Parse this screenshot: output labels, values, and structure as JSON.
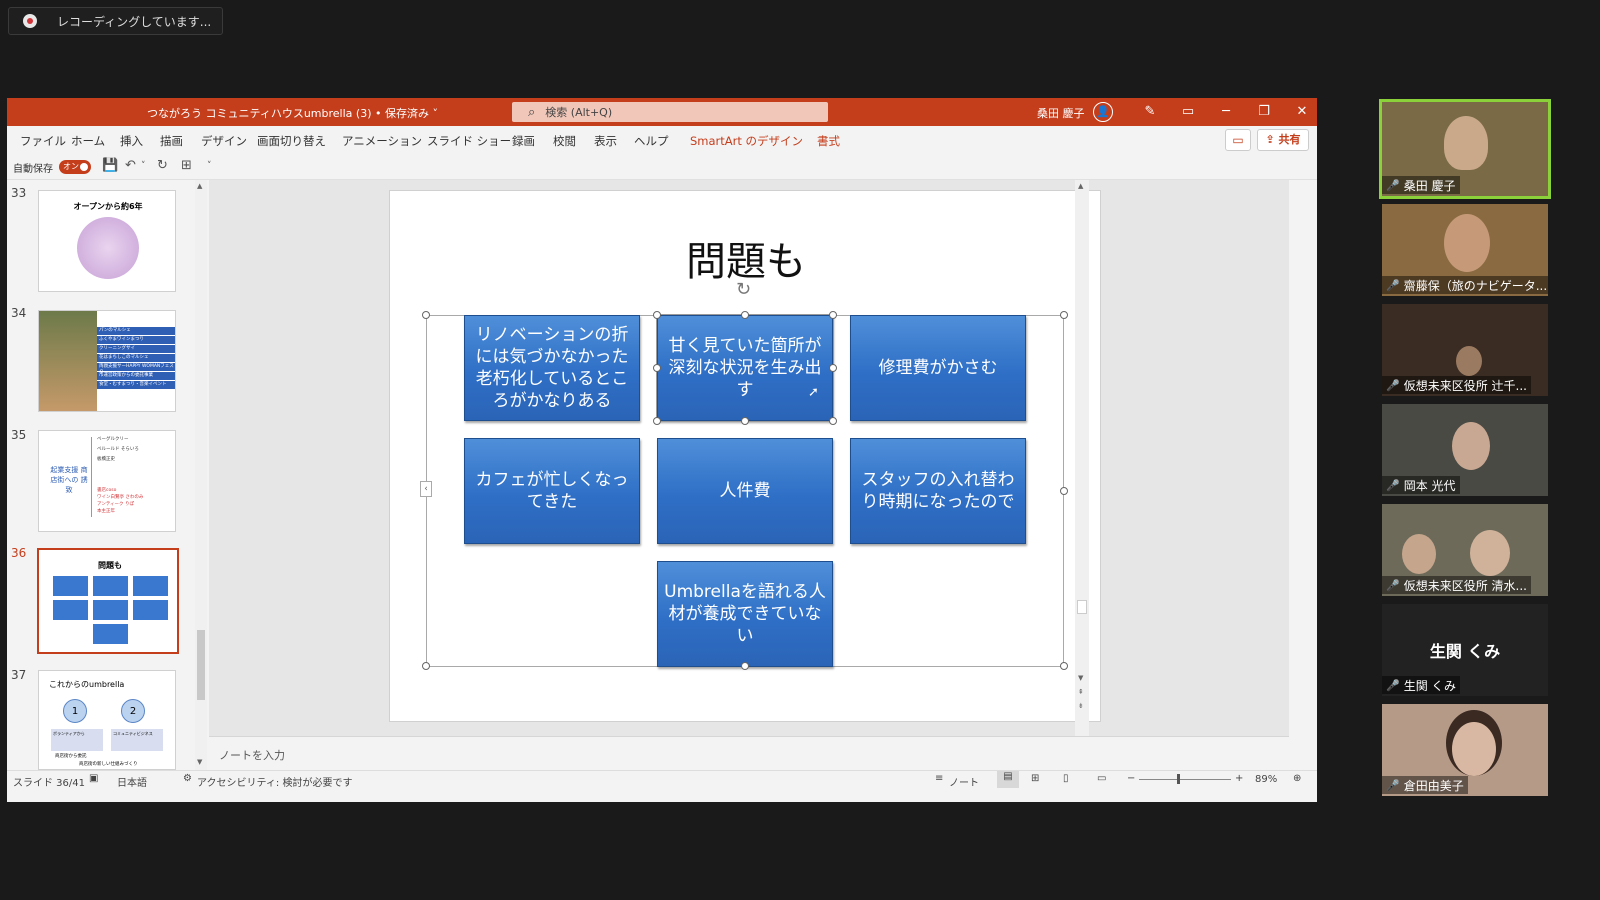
{
  "recording": {
    "label": "レコーディングしています..."
  },
  "powerpoint": {
    "doc_title": "つながろう コミュニティハウスumbrella (3) • 保存済み ˅",
    "search_placeholder": "検索 (Alt+Q)",
    "user_name": "桑田 慶子",
    "menu": [
      "ファイル",
      "ホーム",
      "挿入",
      "描画",
      "デザイン",
      "画面切り替え",
      "アニメーション",
      "スライド ショー",
      "録画",
      "校閲",
      "表示",
      "ヘルプ",
      "SmartArt のデザイン",
      "書式"
    ],
    "share_label": "共有",
    "autosave_label": "自動保存",
    "autosave_state": "オン",
    "thumbnails": [
      {
        "num": "33",
        "title": "オープンから約6年"
      },
      {
        "num": "34",
        "items": [
          "パンのマルシェ",
          "ふくやまワインまつり",
          "クリーニングサイ",
          "花はまちしこのマルシェ",
          "両親支援サーHAPPY WOMANフェスタ",
          "市運営政策からの委託事業",
          "食堂・むすまつり・音楽イベント"
        ]
      },
      {
        "num": "35",
        "title": "起業支援 商店街への 誘致",
        "bullets": [
          "ベーグルクリー",
          "ベルールド そらいろ",
          "板橋正史"
        ],
        "red": [
          "書店coso",
          "ワイン白鷺亭 さわのみ",
          "アンティーク りぽ",
          "本主正年"
        ]
      },
      {
        "num": "36",
        "title": "問題も",
        "current": true
      },
      {
        "num": "37",
        "title": "これからのumbrella",
        "n1": "1",
        "n2": "2",
        "t1": "ボランティアから",
        "t2": "コミュニティビジネス",
        "t3": "自立自主型の運営",
        "t4": "自立自主型の運営",
        "c1": "商店街から委託",
        "c2": "商店街の新しい仕組みづくり"
      }
    ],
    "slide": {
      "title": "問題も",
      "boxes": [
        "リノベーションの折には気づかなかった老朽化しているところがかなりある",
        "甘く見ていた箇所が深刻な状況を生み出す",
        "修理費がかさむ",
        "カフェが忙しくなってきた",
        "人件費",
        "スタッフの入れ替わり時期になったので",
        "Umbrellaを語れる人材が養成できていない"
      ]
    },
    "notes_placeholder": "ノートを入力",
    "status": {
      "slide_info": "スライド 36/41",
      "language": "日本語",
      "accessibility": "アクセシビリティ: 検討が必要です",
      "notes_btn": "ノート",
      "zoom": "89%"
    }
  },
  "participants": [
    {
      "name": "桑田 慶子",
      "muted": false,
      "active": true,
      "bg": "#7a6a45"
    },
    {
      "name": "齋藤保（旅のナビゲータ...",
      "muted": true,
      "bg": "#8a6a40"
    },
    {
      "name": "仮想未来区役所 辻千...",
      "muted": true,
      "bg": "#3a2c22"
    },
    {
      "name": "岡本 光代",
      "muted": true,
      "bg": "#4a4a44"
    },
    {
      "name": "仮想未来区役所 清水...",
      "muted": true,
      "bg": "#6d6a5a"
    },
    {
      "name": "生関 くみ",
      "muted": true,
      "name_only": true,
      "big_name": "生関 くみ",
      "bg": "#222222"
    },
    {
      "name": "倉田由美子",
      "muted": true,
      "bg": "#b59a88"
    }
  ],
  "colors": {
    "accent": "#c43e1c",
    "smartart_blue": "#3a78cf",
    "active_speaker": "#8ad13a"
  }
}
